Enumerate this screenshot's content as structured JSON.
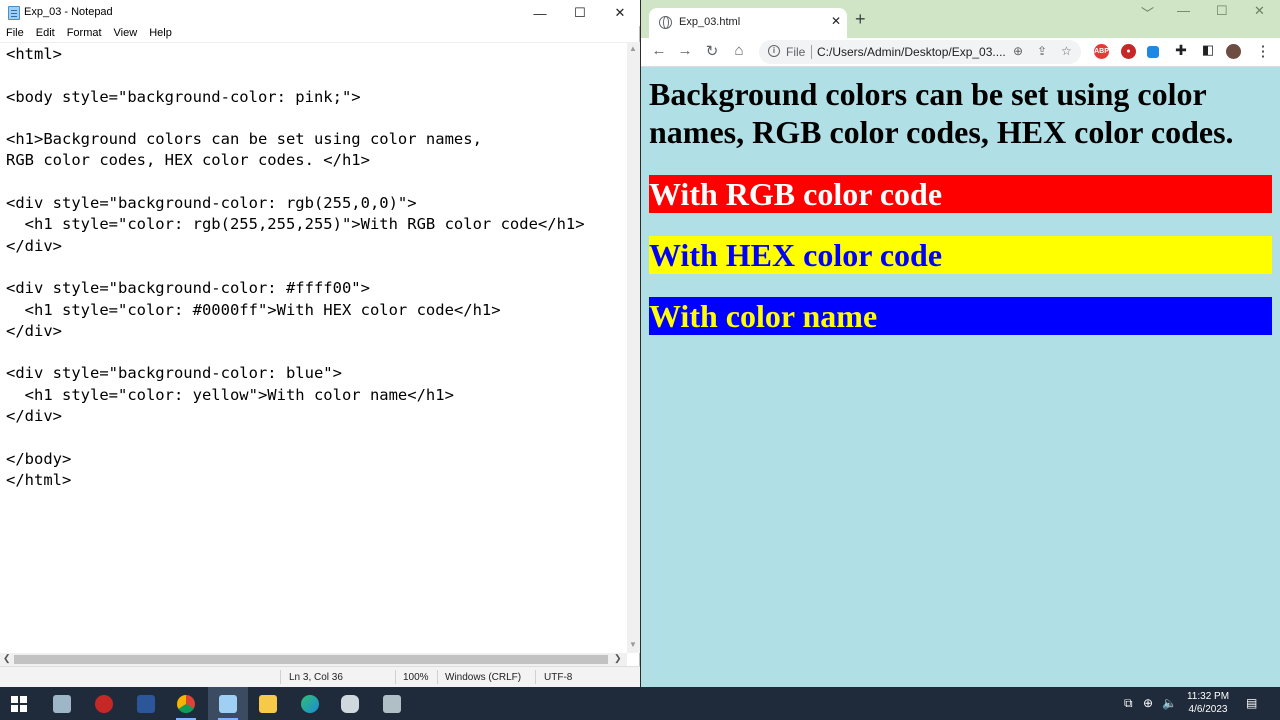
{
  "notepad": {
    "title": "Exp_03 - Notepad",
    "window_controls": {
      "minimize": "—",
      "maximize": "☐",
      "close": "✕"
    },
    "menu": [
      "File",
      "Edit",
      "Format",
      "View",
      "Help"
    ],
    "code": "<html>\n\n<body style=\"background-color: pink;\">\n\n<h1>Background colors can be set using color names,\nRGB color codes, HEX color codes. </h1>\n\n<div style=\"background-color: rgb(255,0,0)\">\n  <h1 style=\"color: rgb(255,255,255)\">With RGB color code</h1>\n</div>\n\n<div style=\"background-color: #ffff00\">\n  <h1 style=\"color: #0000ff\">With HEX color code</h1>\n</div>\n\n<div style=\"background-color: blue\">\n  <h1 style=\"color: yellow\">With color name</h1>\n</div>\n\n</body>\n</html>",
    "status": {
      "position": "Ln 3, Col 36",
      "zoom": "100%",
      "line_ending": "Windows (CRLF)",
      "encoding": "UTF-8"
    }
  },
  "browser": {
    "tab_title": "Exp_03.html",
    "tab_close": "✕",
    "new_tab": "+",
    "window_controls": {
      "minimize": "﹀",
      "restore": "—",
      "maximize": "☐",
      "close": "✕"
    },
    "nav": {
      "back": "←",
      "forward": "→",
      "reload": "↻",
      "home": "⌂"
    },
    "address": {
      "scheme_label": "File",
      "url": "C:/Users/Admin/Desktop/Exp_03...."
    },
    "page": {
      "heading": "Background colors can be set using color names, RGB color codes, HEX color codes.",
      "blocks": [
        {
          "text": "With RGB color code",
          "bg": "#ff0000",
          "fg": "#ffffff"
        },
        {
          "text": "With HEX color code",
          "bg": "#ffff00",
          "fg": "#0000ff"
        },
        {
          "text": "With color name",
          "bg": "#0000ff",
          "fg": "#ffff00"
        }
      ],
      "background": "#b0e0e6"
    }
  },
  "taskbar": {
    "apps": [
      "start",
      "file-explorer-alt",
      "asio",
      "word",
      "chrome",
      "notepad",
      "file-explorer",
      "edge",
      "app-a",
      "app-b"
    ],
    "clock": {
      "time": "11:32 PM",
      "date": "4/6/2023"
    }
  }
}
